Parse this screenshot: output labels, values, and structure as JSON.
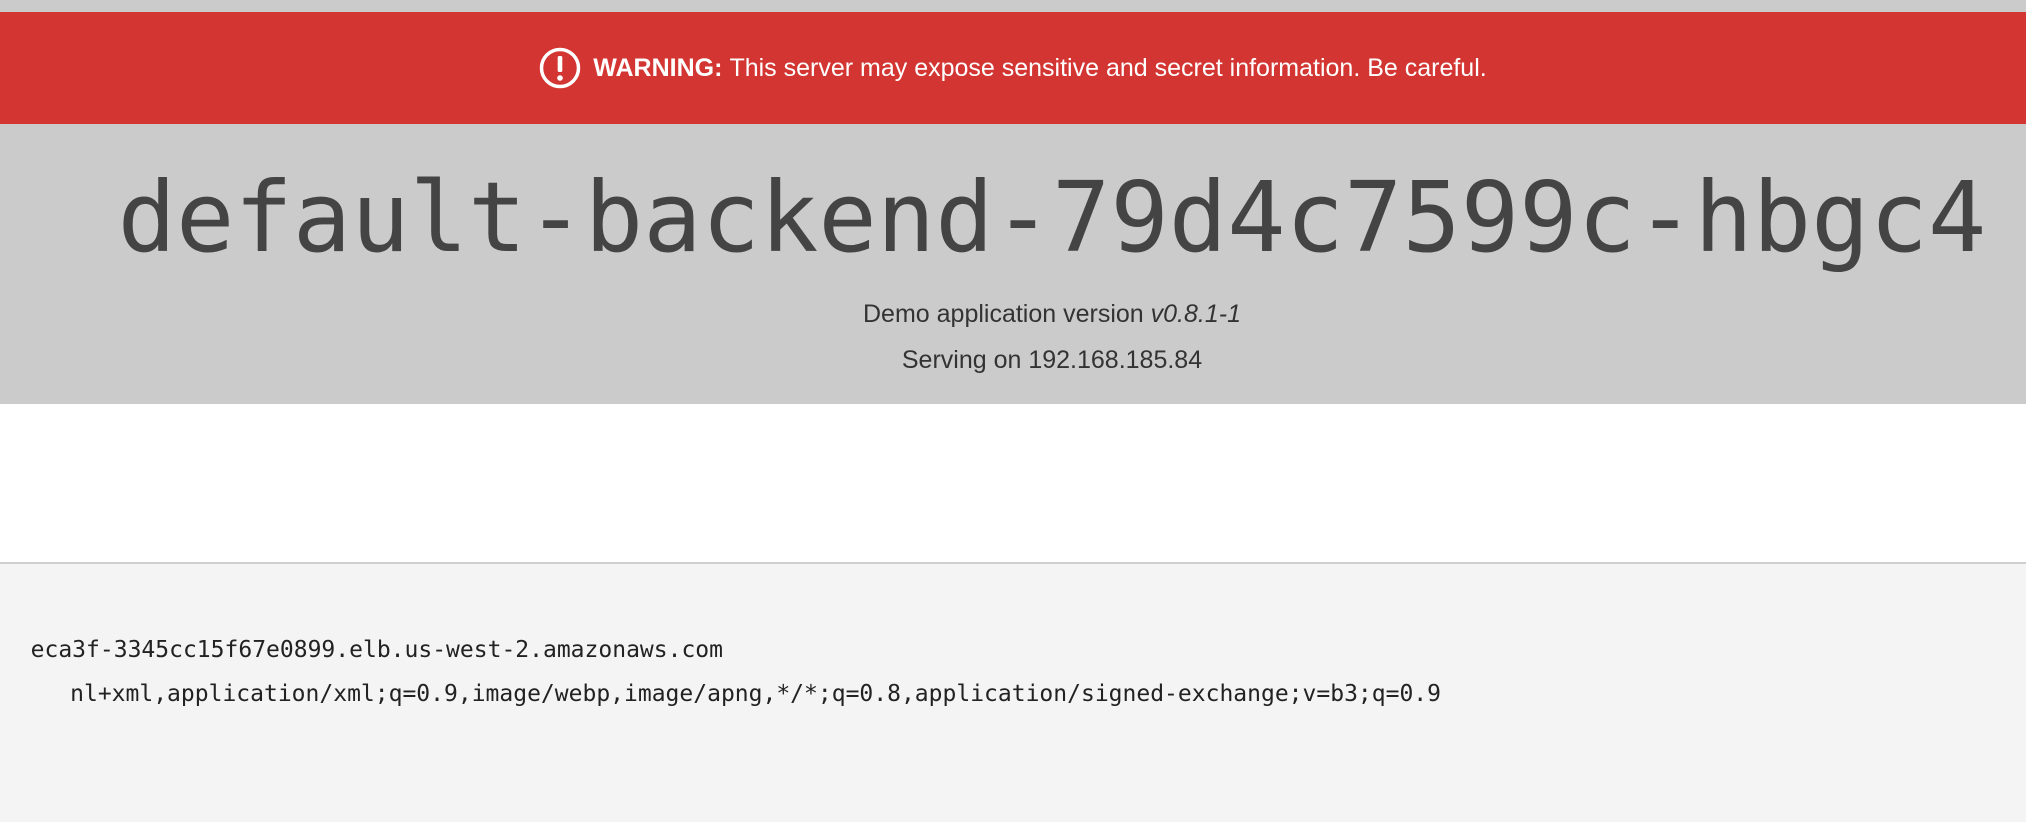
{
  "warning": {
    "label": "WARNING:",
    "message": "This server may expose sensitive and secret information. Be careful.",
    "icon": "exclamation-circle-icon"
  },
  "app": {
    "hostname": "default-backend-79d4c7599c-hbgc4",
    "version_prefix": "Demo application version",
    "version": "v0.8.1-1",
    "serving": "Serving on 192.168.185.84"
  },
  "request_headers": {
    "host_fragment": "eca3f-3345cc15f67e0899.elb.us-west-2.amazonaws.com",
    "accept_fragment": "nl+xml,application/xml;q=0.9,image/webp,image/apng,*/*;q=0.8,application/signed-exchange;v=b3;q=0.9"
  },
  "colors": {
    "warning_bg": "#d33532",
    "hero_bg": "#cbcbcb",
    "panel_bg": "#f4f4f4"
  }
}
